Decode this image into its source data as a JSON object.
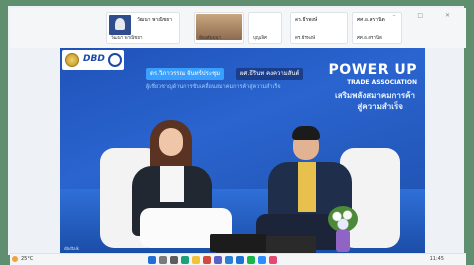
{
  "participants": [
    {
      "id": "p1",
      "name": "วัฒนา พาณิชยา",
      "caption": "วัฒนา พาณิชยา"
    },
    {
      "id": "p2",
      "name": "ห้องสัมมนา",
      "caption": "ห้องสัมมนา"
    },
    {
      "id": "p3",
      "name": "ณ.อ.บุญเลิศ",
      "caption": "บุญเลิศ"
    },
    {
      "id": "p4",
      "name": "ดร.ธีรพงษ์",
      "caption": "ดร.ธีรพงษ์"
    },
    {
      "id": "p5",
      "name": "ศศ.อ.สรานิต",
      "caption": "ศศ.อ.สรานิต"
    }
  ],
  "main_video": {
    "logos": {
      "dbd_text": "DBD"
    },
    "speaker_left": "ดร.วิภาวรรณ จันทร์ประชุม",
    "speaker_right": "ผศ.ธีรินท คงความสันต์",
    "subtitle": "ผู้เชี่ยวชาญด้านการขับเคลื่อนสมาคมการค้าสู่ความสำเร็จ",
    "title_line1": "POWER UP",
    "title_line2": "TRADE ASSOCIATION",
    "title_line3": "เสริมพลังสมาคมการค้า",
    "title_line4": "สู่ความสำเร็จ",
    "host_label": "dbdtalk"
  },
  "taskbar": {
    "weather_text": "25°C",
    "tray_time": "11:45",
    "icons": [
      {
        "name": "start-icon",
        "color": "#1f6fd6"
      },
      {
        "name": "search-icon",
        "color": "#7a7a7a"
      },
      {
        "name": "task-view-icon",
        "color": "#5d5d5d"
      },
      {
        "name": "edge-icon",
        "color": "#1aa17c"
      },
      {
        "name": "file-explorer-icon",
        "color": "#f2c23c"
      },
      {
        "name": "chrome-icon",
        "color": "#d24b3a"
      },
      {
        "name": "teams-icon",
        "color": "#5b5fc7"
      },
      {
        "name": "store-icon",
        "color": "#2b7fd4"
      },
      {
        "name": "mail-icon",
        "color": "#1d73d1"
      },
      {
        "name": "line-icon",
        "color": "#19b44a"
      },
      {
        "name": "zoom-icon",
        "color": "#2d8cff"
      },
      {
        "name": "photos-icon",
        "color": "#e24a71"
      }
    ]
  },
  "colors": {
    "accent_blue": "#2a64cf",
    "badge_blue": "#3aa0ff",
    "badge_dark": "#1a3d8c",
    "frame_green": "#5f8f6f"
  }
}
